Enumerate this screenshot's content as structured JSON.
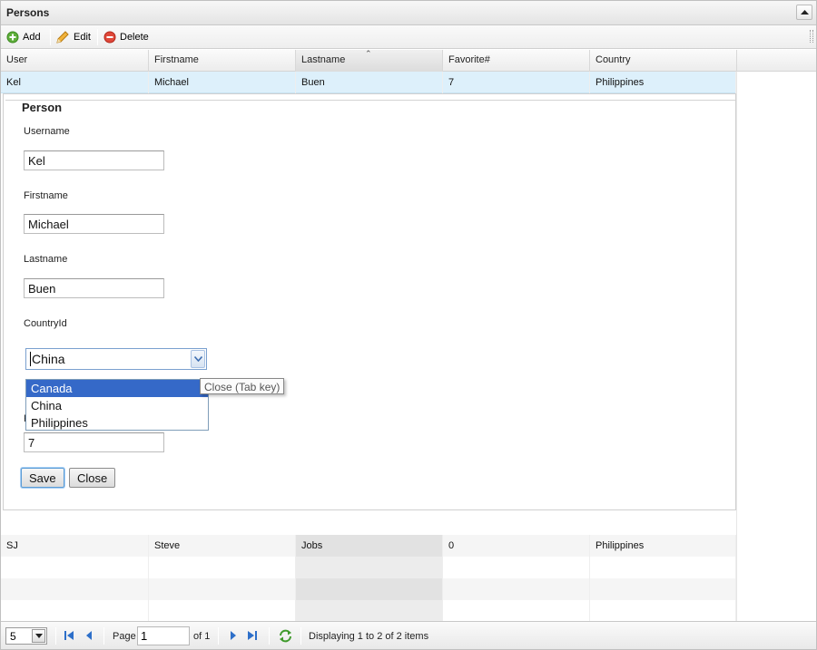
{
  "panel": {
    "title": "Persons"
  },
  "toolbar": {
    "add_label": "Add",
    "edit_label": "Edit",
    "delete_label": "Delete"
  },
  "grid": {
    "columns": [
      "User",
      "Firstname",
      "Lastname",
      "Favorite#",
      "Country"
    ],
    "sorted_column": "Lastname",
    "rows": [
      {
        "user": "Kel",
        "firstname": "Michael",
        "lastname": "Buen",
        "favorite": "7",
        "country": "Philippines"
      },
      {
        "user": "SJ",
        "firstname": "Steve",
        "lastname": "Jobs",
        "favorite": "0",
        "country": "Philippines"
      }
    ]
  },
  "form": {
    "legend": "Person",
    "username_label": "Username",
    "username_value": "Kel",
    "firstname_label": "Firstname",
    "firstname_value": "Michael",
    "lastname_label": "Lastname",
    "lastname_value": "Buen",
    "country_label": "CountryId",
    "country_value": "China",
    "country_options": [
      "Canada",
      "China",
      "Philippines"
    ],
    "tooltip": "Close (Tab key)",
    "favorite_value": "7",
    "save_label": "Save",
    "close_label": "Close"
  },
  "pager": {
    "page_size": "5",
    "page_label": "Page",
    "page_value": "1",
    "of_label": "of 1",
    "status": "Displaying 1 to 2 of 2 items"
  },
  "colors": {
    "selected_row": "#ddf0fb",
    "dropdown_active": "#3569c8"
  }
}
